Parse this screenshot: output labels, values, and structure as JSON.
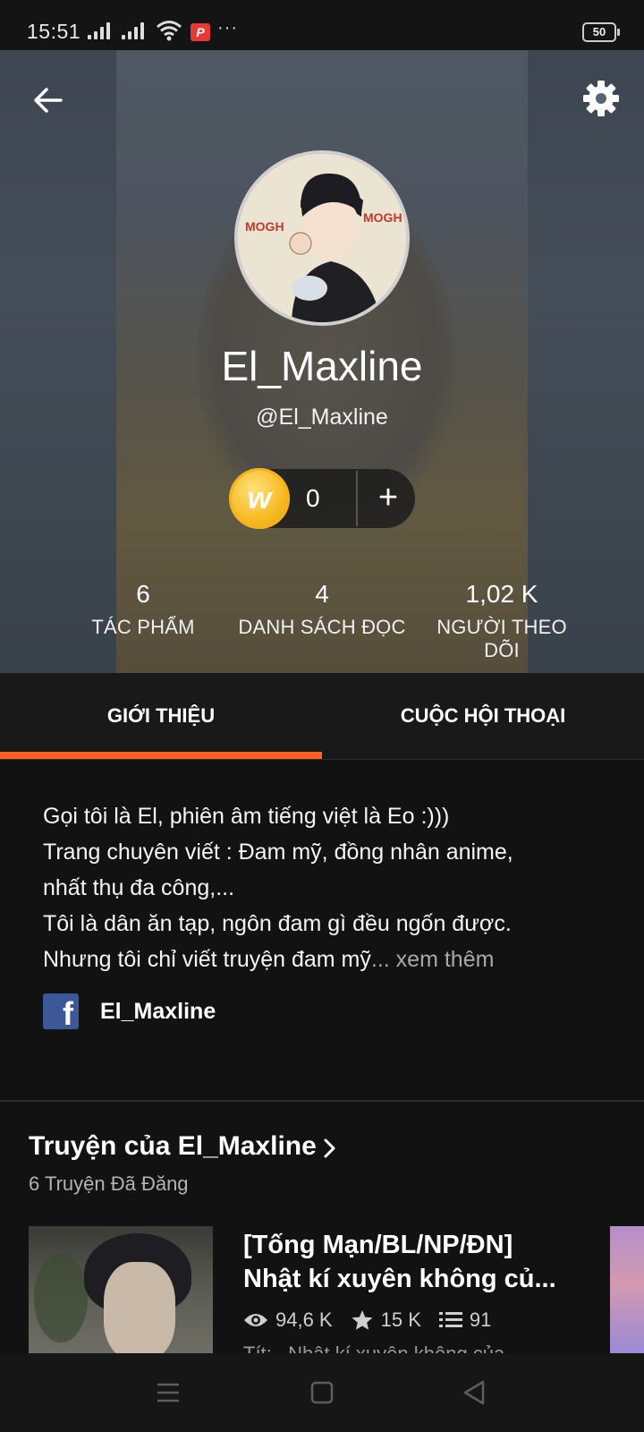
{
  "status_bar": {
    "time": "15:51",
    "battery": "50",
    "more": "···"
  },
  "profile": {
    "display_name": "El_Maxline",
    "username": "@El_Maxline",
    "coins": "0",
    "add_coins": "+"
  },
  "stats": [
    {
      "value": "6",
      "label": "TÁC PHẨM"
    },
    {
      "value": "4",
      "label": "DANH SÁCH ĐỌC"
    },
    {
      "value": "1,02 K",
      "label": "NGƯỜI THEO DÕI"
    }
  ],
  "tabs": [
    {
      "label": "GIỚI THIỆU",
      "selected": true
    },
    {
      "label": "CUỘC HỘI THOẠI",
      "selected": false
    }
  ],
  "about": {
    "lines": [
      "Gọi tôi là El, phiên âm tiếng việt là Eo :)))",
      "Trang chuyên viết : Đam mỹ, đồng nhân anime,",
      "nhất thụ đa công,...",
      "Tôi là dân ăn tạp, ngôn đam gì đều ngốn được.",
      "Nhưng tôi chỉ viết truyện đam mỹ"
    ],
    "ellipsis": "...",
    "see_more": " xem thêm",
    "facebook_name": "El_Maxline"
  },
  "stories": {
    "title": "Truyện của El_Maxline",
    "count": "6 Truyện Đã Đăng",
    "items": [
      {
        "title_lines": [
          "[Tống Mạn/BL/NP/ĐN]",
          "Nhật kí xuyên không củ..."
        ],
        "views": "94,6 K",
        "votes": "15 K",
        "parts": "91",
        "description": "Tít:..  Nhật kí xuyên không của..."
      }
    ]
  },
  "colors": {
    "accent": "#ff6122",
    "background": "#121212",
    "facebook": "#3b5998",
    "coin": "#f6b81f"
  }
}
